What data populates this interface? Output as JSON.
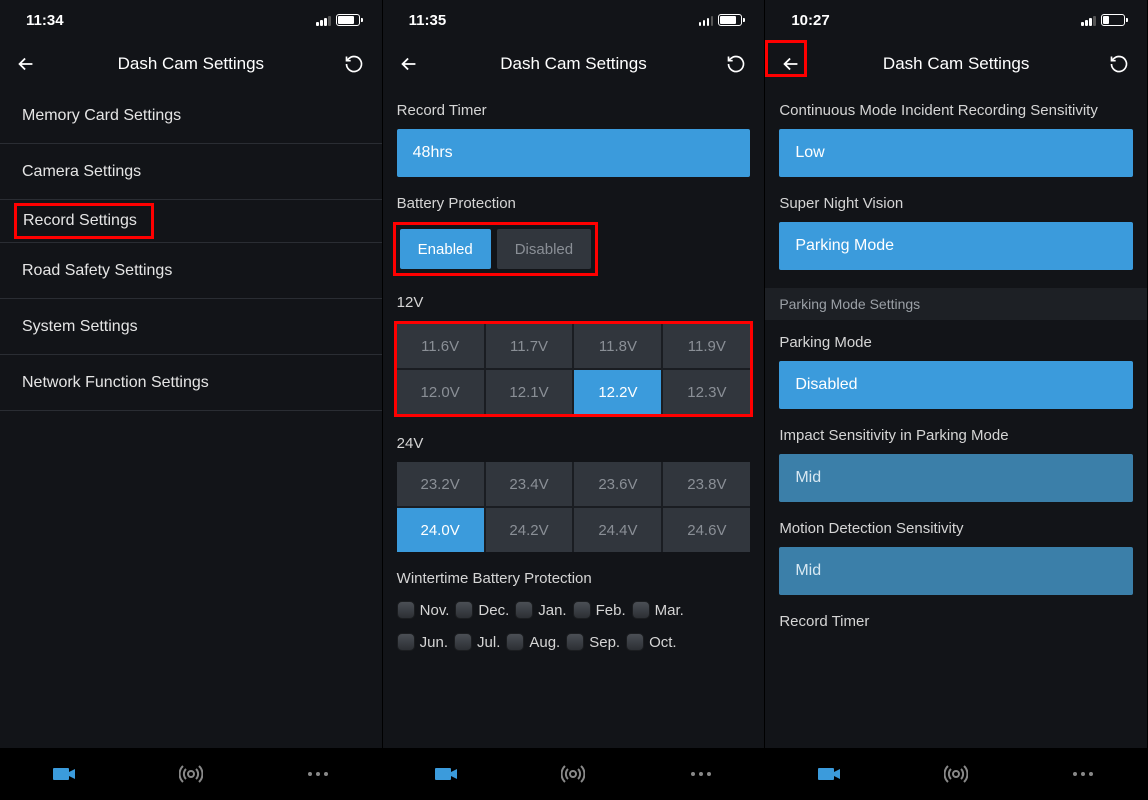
{
  "screens": [
    {
      "status": {
        "time": "11:34",
        "battery_fill": "80%"
      },
      "header_title": "Dash Cam Settings",
      "menu": [
        "Memory Card Settings",
        "Camera Settings",
        "Record Settings",
        "Road Safety Settings",
        "System Settings",
        "Network Function Settings"
      ],
      "highlighted_index": 2
    },
    {
      "status": {
        "time": "11:35",
        "battery_fill": "80%"
      },
      "header_title": "Dash Cam Settings",
      "record_timer": {
        "label": "Record Timer",
        "value": "48hrs"
      },
      "battery_protection": {
        "label": "Battery Protection",
        "options": [
          "Enabled",
          "Disabled"
        ],
        "active_index": 0
      },
      "v12": {
        "label": "12V",
        "options": [
          "11.6V",
          "11.7V",
          "11.8V",
          "11.9V",
          "12.0V",
          "12.1V",
          "12.2V",
          "12.3V"
        ],
        "active_index": 6
      },
      "v24": {
        "label": "24V",
        "options": [
          "23.2V",
          "23.4V",
          "23.6V",
          "23.8V",
          "24.0V",
          "24.2V",
          "24.4V",
          "24.6V"
        ],
        "active_index": 4
      },
      "winter": {
        "label": "Wintertime Battery Protection",
        "row1": [
          "Nov.",
          "Dec.",
          "Jan.",
          "Feb.",
          "Mar."
        ],
        "row2": [
          "Jun.",
          "Jul.",
          "Aug.",
          "Sep.",
          "Oct."
        ]
      }
    },
    {
      "status": {
        "time": "10:27",
        "battery_fill": "30%"
      },
      "header_title": "Dash Cam Settings",
      "cont_mode": {
        "label": "Continuous Mode Incident Recording Sensitivity",
        "value": "Low"
      },
      "night_vision": {
        "label": "Super Night Vision",
        "value": "Parking Mode"
      },
      "sub_header": "Parking Mode Settings",
      "parking_mode": {
        "label": "Parking Mode",
        "value": "Disabled"
      },
      "impact": {
        "label": "Impact Sensitivity in Parking Mode",
        "value": "Mid"
      },
      "motion": {
        "label": "Motion Detection Sensitivity",
        "value": "Mid"
      },
      "timer": {
        "label": "Record Timer"
      }
    }
  ]
}
